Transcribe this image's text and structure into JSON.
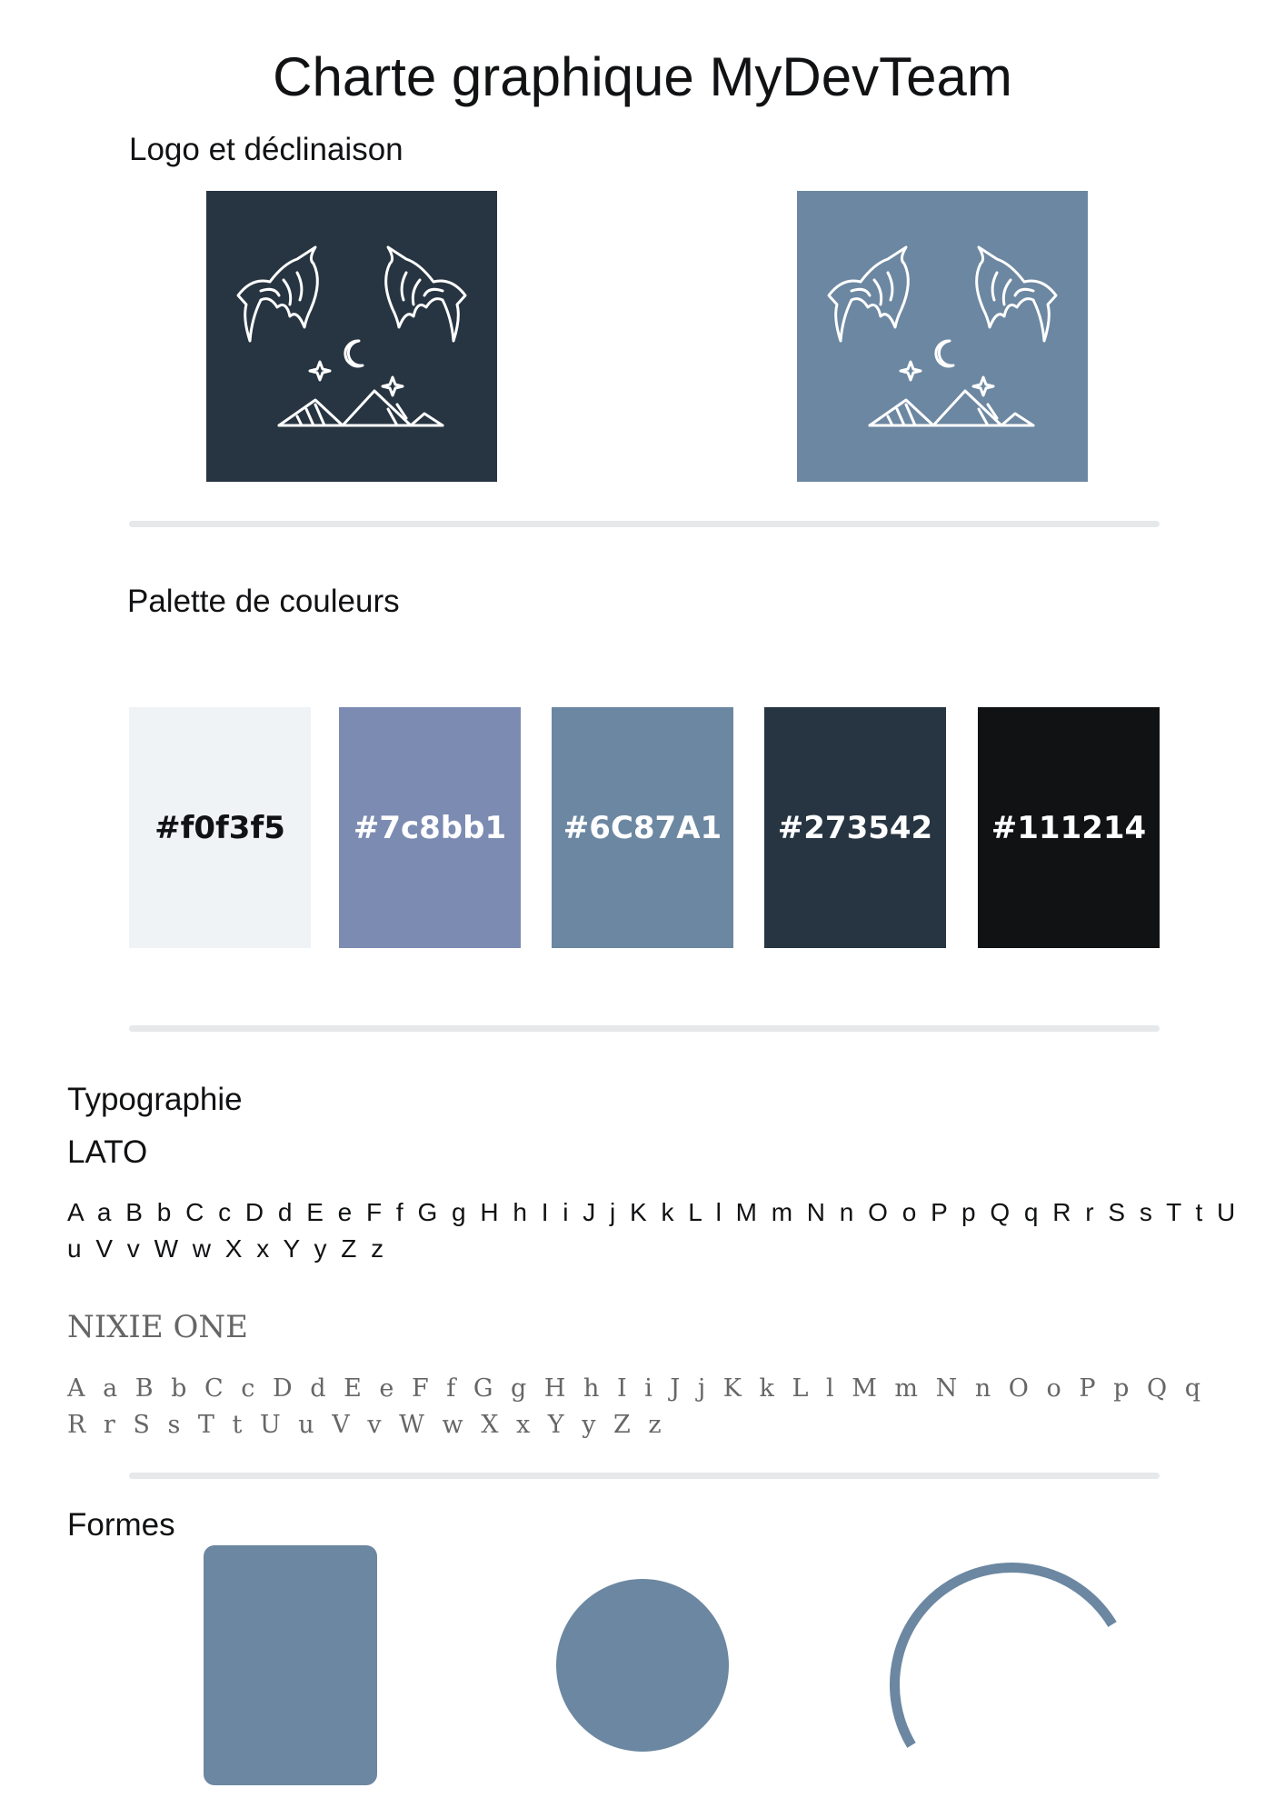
{
  "title": "Charte graphique MyDevTeam",
  "sections": {
    "logo": "Logo et déclinaison",
    "palette": "Palette de couleurs",
    "typography": "Typographie",
    "shapes": "Formes"
  },
  "logos": [
    {
      "background": "#273542",
      "icon": "howling-wolves-logo"
    },
    {
      "background": "#6C87A1",
      "icon": "howling-wolves-logo"
    }
  ],
  "palette": [
    {
      "label": "#f0f3f5",
      "color": "#f0f3f5",
      "text_color": "#111214"
    },
    {
      "label": "#7c8bb1",
      "color": "#7c8bb1",
      "text_color": "#ffffff"
    },
    {
      "label": "#6C87A1",
      "color": "#6C87A1",
      "text_color": "#ffffff"
    },
    {
      "label": "#273542",
      "color": "#273542",
      "text_color": "#ffffff"
    },
    {
      "label": "#111214",
      "color": "#111214",
      "text_color": "#ffffff"
    }
  ],
  "fonts": [
    {
      "name": "LATO",
      "alphabet": "A a B b C c D d E e F f G g H h I i J j K k L l M m N n O o P p Q q R r S s T t U u V v W w X x Y y Z z"
    },
    {
      "name": "NIXIE ONE",
      "alphabet": "A a B b C c D d E e F f G g H h I i J j K k L l M m N n O o P p Q q R r S s T t U u V v W w X x Y y Z z"
    }
  ],
  "shapes": [
    {
      "type": "rounded-rectangle",
      "color": "#6C87A1"
    },
    {
      "type": "circle",
      "color": "#6C87A1"
    },
    {
      "type": "arc",
      "color": "#6C87A1"
    }
  ]
}
